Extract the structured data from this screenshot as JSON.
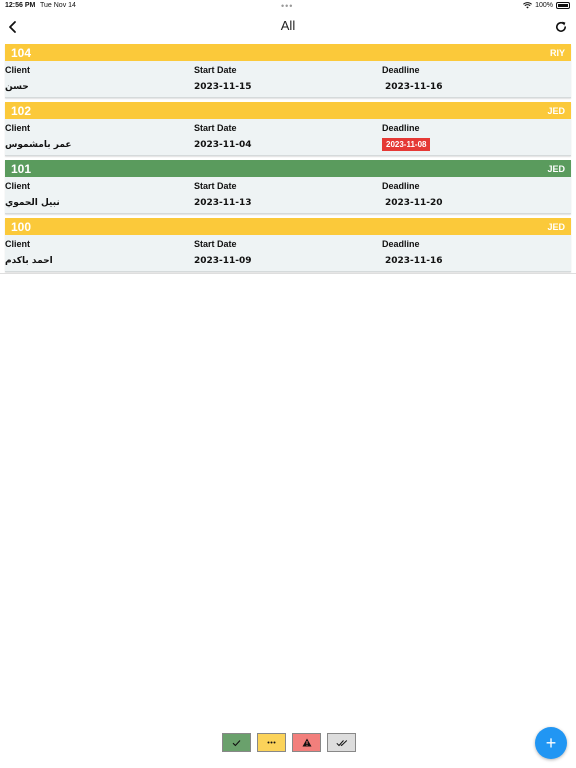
{
  "status_bar": {
    "time": "12:56 PM",
    "date": "Tue Nov 14",
    "battery": "100%"
  },
  "nav": {
    "title": "All"
  },
  "columns": {
    "client": "Client",
    "start": "Start Date",
    "deadline": "Deadline"
  },
  "orders": [
    {
      "id": "104",
      "region": "RIY",
      "client": "حسن",
      "start": "2023-11-15",
      "deadline": "2023-11-16",
      "status": "in-progress",
      "overdue": false
    },
    {
      "id": "102",
      "region": "JED",
      "client": "عمر بامشموس",
      "start": "2023-11-04",
      "deadline": "2023-11-08",
      "status": "in-progress",
      "overdue": true
    },
    {
      "id": "101",
      "region": "JED",
      "client": "نبيل الحموي",
      "start": "2023-11-13",
      "deadline": "2023-11-20",
      "status": "done",
      "overdue": false
    },
    {
      "id": "100",
      "region": "JED",
      "client": "احمد باكدم",
      "start": "2023-11-09",
      "deadline": "2023-11-16",
      "status": "in-progress",
      "overdue": false
    }
  ],
  "filters": [
    {
      "icon": "check-icon",
      "color": "#6aa16c"
    },
    {
      "icon": "ellipsis-icon",
      "color": "#fbd35a"
    },
    {
      "icon": "warning-icon",
      "color": "#f27f7c"
    },
    {
      "icon": "double-check-icon",
      "color": "#dddddd"
    }
  ],
  "colors": {
    "in_progress": "#fbc93a",
    "done": "#5a9b5d",
    "overdue": "#e53935",
    "fab": "#2196f3"
  }
}
